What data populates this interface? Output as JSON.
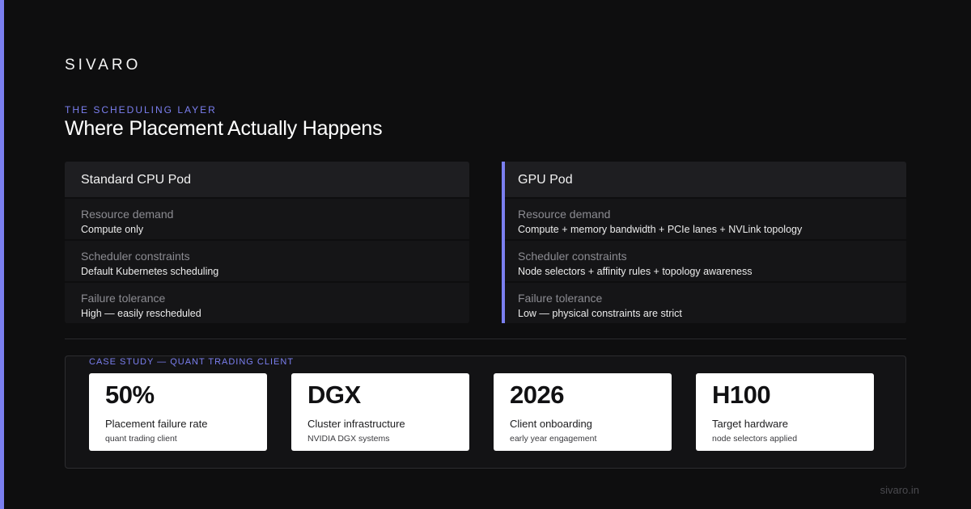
{
  "brand": {
    "logo": "SIVARO",
    "accent_color": "#7b7ff0"
  },
  "header": {
    "eyebrow": "THE SCHEDULING LAYER",
    "title": "Where Placement Actually Happens"
  },
  "comparison": {
    "left": {
      "title": "Standard CPU Pod",
      "rows": [
        {
          "label": "Resource demand",
          "value": "Compute only"
        },
        {
          "label": "Scheduler constraints",
          "value": "Default Kubernetes scheduling"
        },
        {
          "label": "Failure tolerance",
          "value": "High — easily rescheduled"
        }
      ]
    },
    "right": {
      "title": "GPU Pod",
      "rows": [
        {
          "label": "Resource demand",
          "value": "Compute + memory bandwidth + PCIe lanes + NVLink topology"
        },
        {
          "label": "Scheduler constraints",
          "value": "Node selectors + affinity rules + topology awareness"
        },
        {
          "label": "Failure tolerance",
          "value": "Low — physical constraints are strict"
        }
      ]
    }
  },
  "case_study": {
    "label": "CASE STUDY — QUANT TRADING CLIENT",
    "stats": [
      {
        "value": "50%",
        "label": "Placement failure rate",
        "sub": "quant trading client"
      },
      {
        "value": "DGX",
        "label": "Cluster infrastructure",
        "sub": "NVIDIA DGX systems"
      },
      {
        "value": "2026",
        "label": "Client onboarding",
        "sub": "early year engagement"
      },
      {
        "value": "H100",
        "label": "Target hardware",
        "sub": "node selectors applied"
      }
    ]
  },
  "footer": {
    "url": "sivaro.in"
  }
}
